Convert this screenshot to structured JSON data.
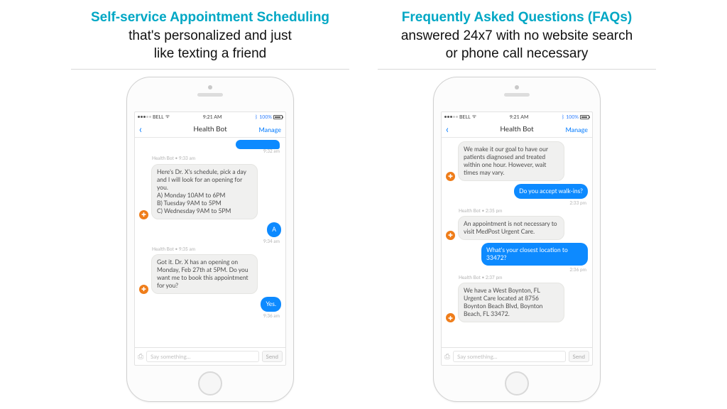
{
  "colA": {
    "title": "Self-service Appointment Scheduling",
    "sub1": "that's personalized and just",
    "sub2": "like texting a friend"
  },
  "colB": {
    "title": "Frequently Asked Questions (FAQs)",
    "sub1": "answered 24x7 with no website search",
    "sub2": "or phone call necessary"
  },
  "status": {
    "carrier": "BELL",
    "time": "9:21 AM",
    "battery": "100%"
  },
  "header": {
    "title": "Health Bot",
    "manage": "Manage"
  },
  "input": {
    "placeholder": "Say something...",
    "send": "Send"
  },
  "chatA": {
    "stub_ts": "9:32 am",
    "m1_meta": "Health Bot • 9:33 am",
    "m1_l1": "Here's Dr. X's schedule, pick a day and I will look for an opening for you.",
    "m1_l2": "A) Monday 10AM to 6PM",
    "m1_l3": "B) Tuesday 9AM to 5PM",
    "m1_l4": "C) Wednesday 9AM to 5PM",
    "u1": "A",
    "u1_ts": "9:34 am",
    "m2_meta": "Health Bot • 9:35 am",
    "m2": "Got it. Dr. X has an opening on Monday, Feb 27th at 5PM. Do you want me to book this appointment for you?",
    "u2": "Yes.",
    "u2_ts": "9:36 am"
  },
  "chatB": {
    "m1": "We make it our goal to have our patients diagnosed and treated within one hour. However, wait times may vary.",
    "u1": "Do you accept walk-ins?",
    "u1_ts": "2:33 pm",
    "m2_meta": "Health Bot • 2:35 pm",
    "m2": "An appointment is not necessary to visit MedPost Urgent Care.",
    "u2": "What's your closest location to 33472?",
    "u2_ts": "2:36 pm",
    "m3_meta": "Health Bot • 2:37 pm",
    "m3": "We have a West Boynton, FL Urgent Care located at 8756 Boynton Beach Blvd, Boynton Beach, FL 33472."
  },
  "avatar_glyph": "✚"
}
